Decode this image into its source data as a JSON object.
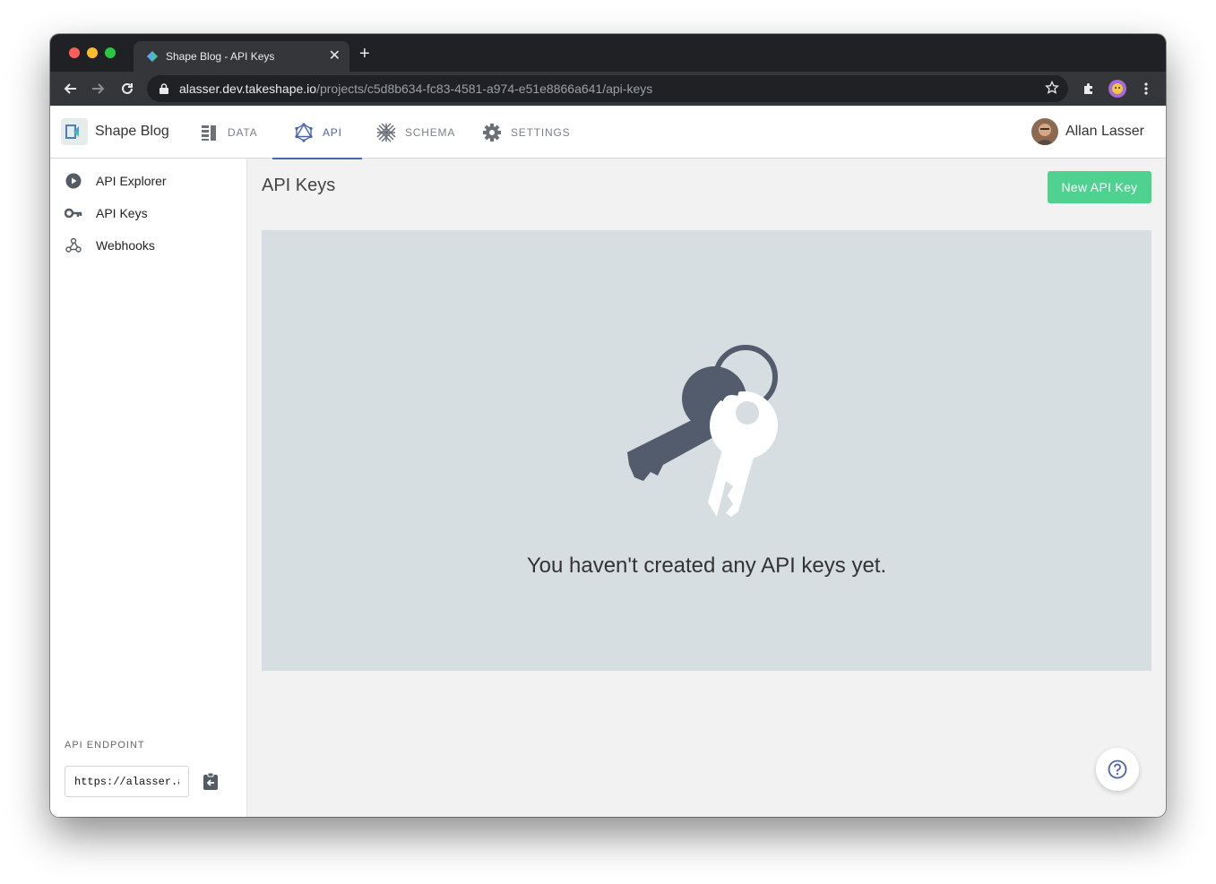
{
  "browser": {
    "tab_title": "Shape Blog - API Keys",
    "url_host": "alasser.dev.takeshape.io",
    "url_path": "/projects/c5d8b634-fc83-4581-a974-e51e8866a641/api-keys"
  },
  "header": {
    "brand": "Shape Blog",
    "nav": [
      {
        "label": "DATA",
        "icon": "data-icon"
      },
      {
        "label": "API",
        "icon": "api-icon",
        "active": true
      },
      {
        "label": "SCHEMA",
        "icon": "schema-icon"
      },
      {
        "label": "SETTINGS",
        "icon": "gear-icon"
      }
    ],
    "user_name": "Allan Lasser"
  },
  "sidebar": {
    "items": [
      {
        "label": "API Explorer",
        "icon": "play-icon"
      },
      {
        "label": "API Keys",
        "icon": "key-icon"
      },
      {
        "label": "Webhooks",
        "icon": "webhook-icon"
      }
    ],
    "endpoint_label": "API ENDPOINT",
    "endpoint_value": "https://alasser.api.takeshape.io"
  },
  "main": {
    "title": "API Keys",
    "new_button": "New API Key",
    "empty_message": "You haven't created any API keys yet."
  },
  "colors": {
    "accent": "#4a63b0",
    "primary_button": "#4fd18f",
    "empty_panel": "#d7dee1"
  }
}
